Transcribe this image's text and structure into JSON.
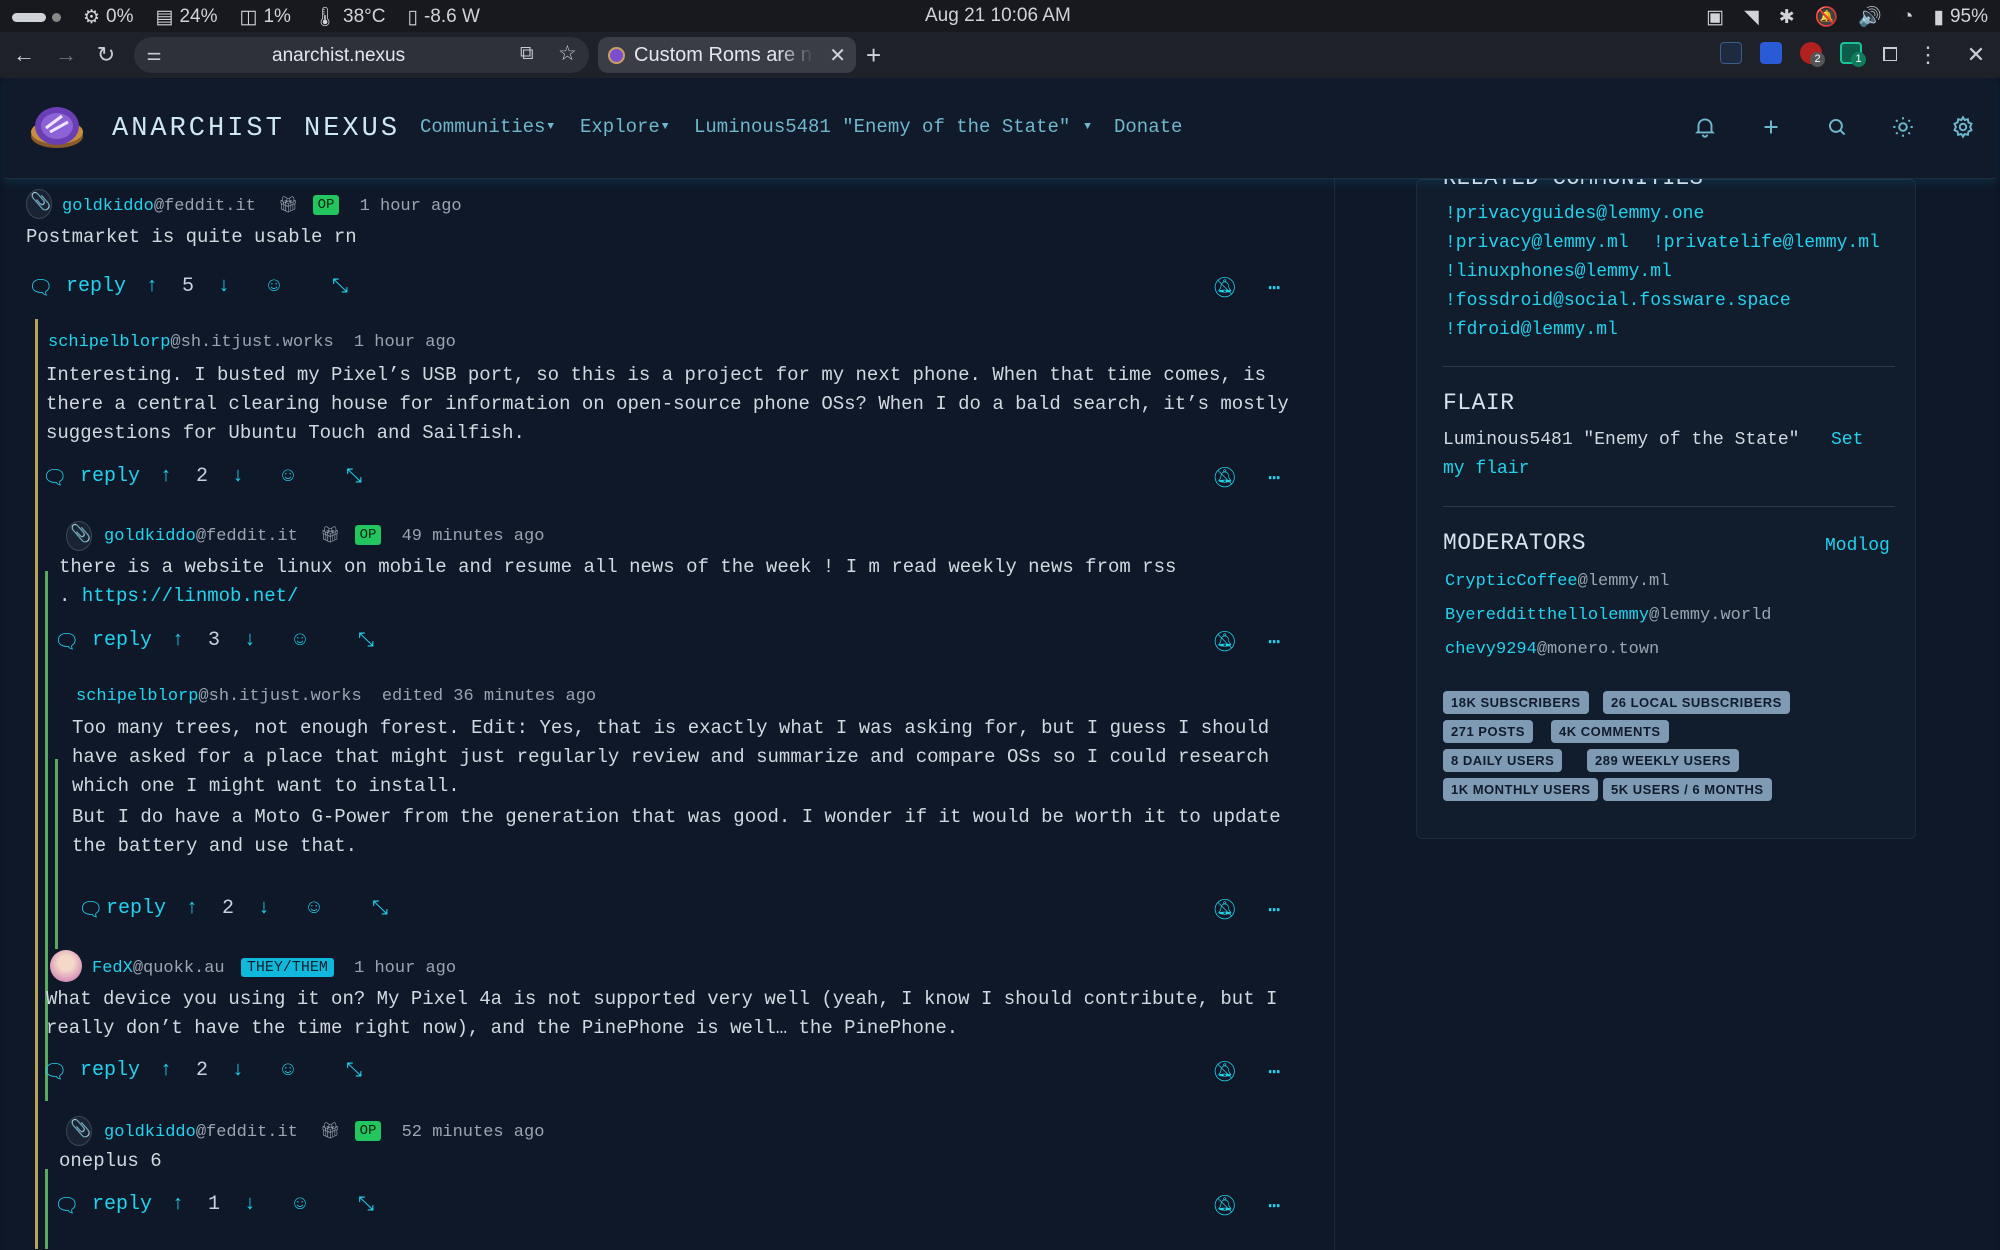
{
  "os": {
    "cpu": "0%",
    "mem": "24%",
    "disk": "1%",
    "temp": "38°C",
    "power": "-8.6 W",
    "clock": "Aug 21  10:06 AM",
    "battery": "95%"
  },
  "browser": {
    "url": "anarchist.nexus",
    "tab_title": "Custom Roms are n",
    "ext_badges": [
      "2",
      "1"
    ]
  },
  "site": {
    "brand": "ANARCHIST NEXUS",
    "nav": {
      "communities": "Communities",
      "explore": "Explore",
      "user": "Luminous5481 \"Enemy of the State\"",
      "donate": "Donate"
    }
  },
  "comments": [
    {
      "user": "goldkiddo",
      "instance": "@feddit.it",
      "op": "OP",
      "time": "1 hour ago",
      "body": "Postmarket is quite usable rn",
      "reply": "reply",
      "score": "5"
    },
    {
      "user": "schipelblorp",
      "instance": "@sh.itjust.works",
      "time": "1 hour ago",
      "body": "Interesting. I busted my Pixel’s USB port, so this is a project for my next phone. When that time comes, is\nthere a central clearing house for information on open-source phone OSs? When I do a bald search, it’s mostly\nsuggestions for Ubuntu Touch and Sailfish.",
      "reply": "reply",
      "score": "2"
    },
    {
      "user": "goldkiddo",
      "instance": "@feddit.it",
      "op": "OP",
      "time": "49 minutes ago",
      "body": "there is a website linux on mobile and resume all news of the week ! I m read weekly news from rss\n. ",
      "link": "https://linmob.net/",
      "reply": "reply",
      "score": "3"
    },
    {
      "user": "schipelblorp",
      "instance": "@sh.itjust.works",
      "time": "edited 36 minutes ago",
      "body": "Too many trees, not enough forest. Edit: Yes, that is exactly what I was asking for, but I guess I should\nhave asked for a place that might just regularly review and summarize and compare OSs so I could research\nwhich one I might want to install.",
      "body2": "But I do have a Moto G-Power from the generation that was good. I wonder if it would be worth it to update\nthe battery and use that.",
      "reply": "reply",
      "score": "2"
    },
    {
      "user": "FedX",
      "instance": "@quokk.au",
      "flair": "THEY/THEM",
      "time": "1 hour ago",
      "body": "What device you using it on? My Pixel 4a is not supported very well (yeah, I know I should contribute, but I\nreally don’t have the time right now), and the PinePhone is well… the PinePhone.",
      "reply": "reply",
      "score": "2"
    },
    {
      "user": "goldkiddo",
      "instance": "@feddit.it",
      "op": "OP",
      "time": "52 minutes ago",
      "body": "oneplus 6",
      "reply": "reply",
      "score": "1"
    }
  ],
  "sidebar": {
    "related_heading": "RELATED COMMUNITIES",
    "related": [
      "!privacyguides@lemmy.one",
      "!privacy@lemmy.ml",
      "!privatelife@lemmy.ml",
      "!linuxphones@lemmy.ml",
      "!fossdroid@social.fossware.space",
      "!fdroid@lemmy.ml"
    ],
    "flair_heading": "FLAIR",
    "flair_user": "Luminous5481 \"Enemy of the State\"",
    "flair_set_1": "Set",
    "flair_set_2": "my flair",
    "mods_heading": "MODERATORS",
    "modlog": "Modlog",
    "mods": [
      {
        "name": "CrypticCoffee",
        "instance": "@lemmy.ml"
      },
      {
        "name": "Byeredditthellolemmy",
        "instance": "@lemmy.world"
      },
      {
        "name": "chevy9294",
        "instance": "@monero.town"
      }
    ],
    "stats": [
      "18K SUBSCRIBERS",
      "26 LOCAL SUBSCRIBERS",
      "271 POSTS",
      "4K COMMENTS",
      "8 DAILY USERS",
      "289 WEEKLY USERS",
      "1K MONTHLY USERS",
      "5K USERS / 6 MONTHS"
    ]
  }
}
